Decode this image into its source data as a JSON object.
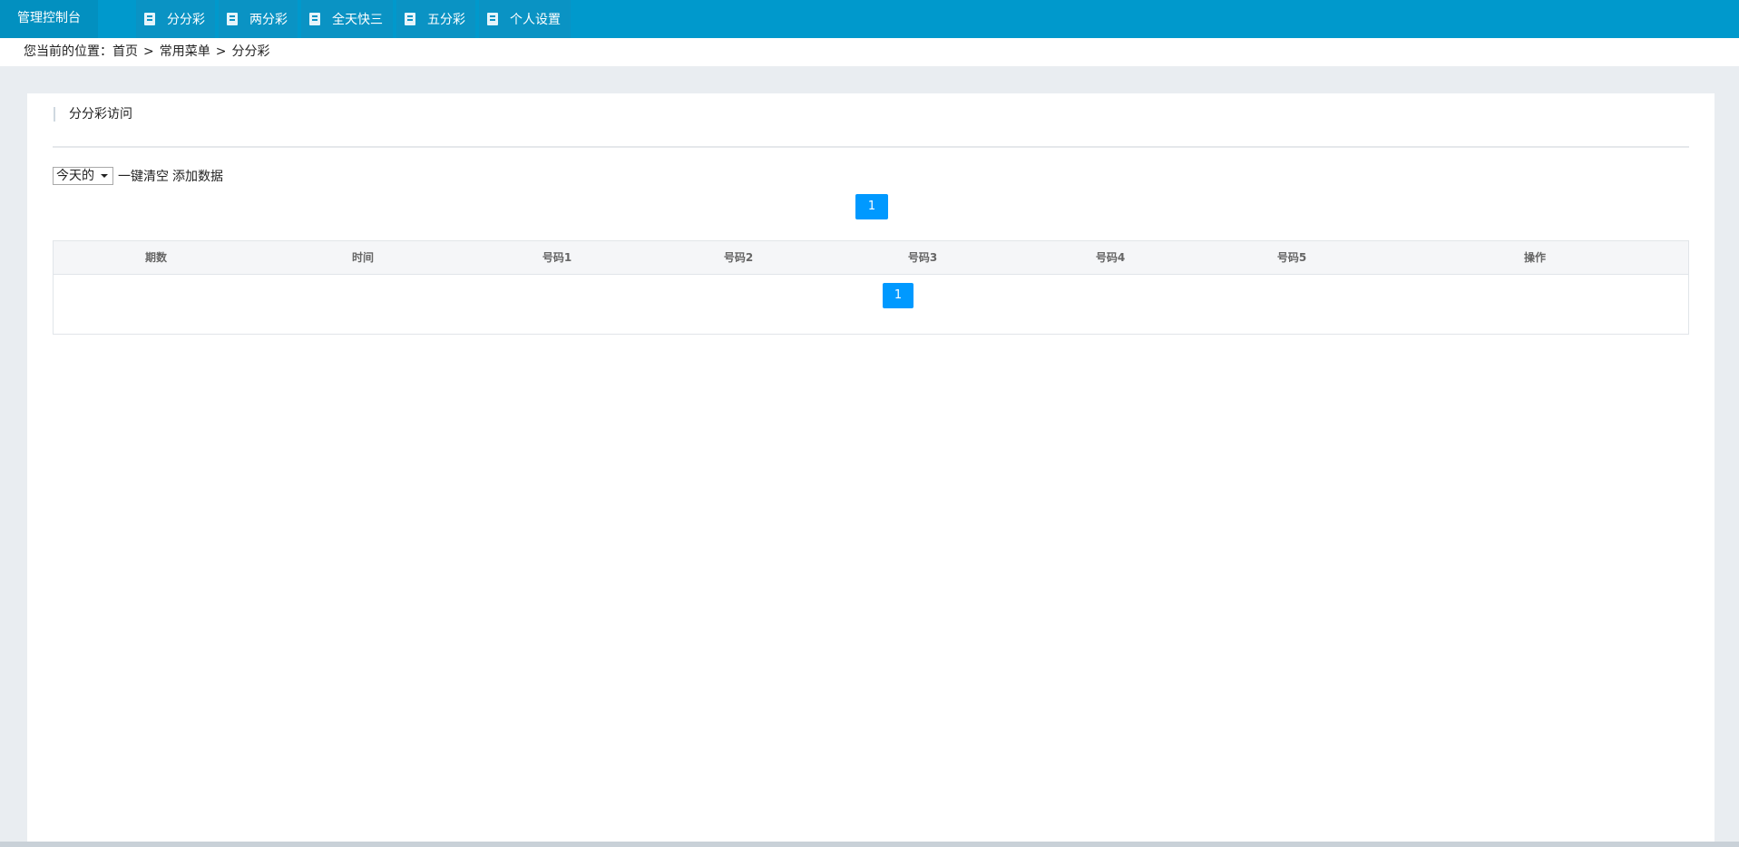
{
  "header": {
    "brand": "管理控制台",
    "nav": [
      {
        "label": "分分彩",
        "icon": "document-icon"
      },
      {
        "label": "两分彩",
        "icon": "document-icon"
      },
      {
        "label": "全天快三",
        "icon": "document-icon"
      },
      {
        "label": "五分彩",
        "icon": "document-icon"
      },
      {
        "label": "个人设置",
        "icon": "document-icon"
      }
    ]
  },
  "breadcrumb": {
    "prefix": "您当前的位置：",
    "items": [
      "首页",
      "常用菜单",
      "分分彩"
    ],
    "separator": ">"
  },
  "section": {
    "title": "分分彩访问"
  },
  "toolbar": {
    "select_value": "今天的",
    "clear_label": "一键清空",
    "add_label": "添加数据"
  },
  "pagination": {
    "current": "1"
  },
  "table": {
    "columns": [
      "期数",
      "时间",
      "号码1",
      "号码2",
      "号码3",
      "号码4",
      "号码5",
      "操作"
    ],
    "rows": []
  },
  "colors": {
    "header_bg": "#0099cc",
    "pager_bg": "#0099ff",
    "page_bg": "#e9edf1"
  }
}
